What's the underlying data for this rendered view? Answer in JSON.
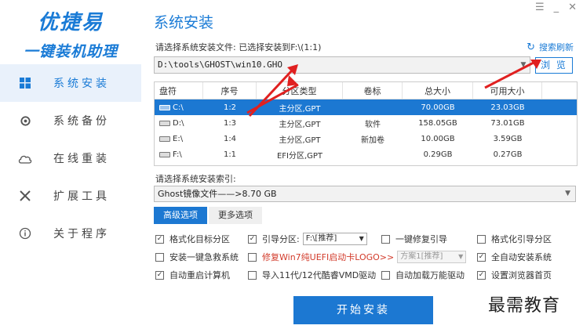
{
  "brand": {
    "title": "优捷易",
    "subtitle": "一键装机助理"
  },
  "window_controls": [
    "☰",
    "_",
    "✕"
  ],
  "nav": [
    {
      "label": "系统安装",
      "icon": "windows-icon",
      "active": true
    },
    {
      "label": "系统备份",
      "icon": "backup-icon",
      "active": false
    },
    {
      "label": "在线重装",
      "icon": "cloud-icon",
      "active": false
    },
    {
      "label": "扩展工具",
      "icon": "tools-icon",
      "active": false
    },
    {
      "label": "关于程序",
      "icon": "info-icon",
      "active": false
    }
  ],
  "main": {
    "title": "系统安装",
    "file_label": "请选择系统安装文件: 已选择安装到F:\\(1:1)",
    "refresh_label": "搜索刷新",
    "path_value": "D:\\tools\\GHOST\\win10.GHO",
    "browse_label": "浏 览"
  },
  "table": {
    "headers": [
      "盘符",
      "序号",
      "分区类型",
      "卷标",
      "总大小",
      "可用大小"
    ],
    "rows": [
      [
        "C:\\",
        "1:2",
        "主分区,GPT",
        "",
        "70.00GB",
        "23.03GB"
      ],
      [
        "D:\\",
        "1:3",
        "主分区,GPT",
        "软件",
        "158.05GB",
        "73.01GB"
      ],
      [
        "E:\\",
        "1:4",
        "主分区,GPT",
        "新加卷",
        "10.00GB",
        "3.59GB"
      ],
      [
        "F:\\",
        "1:1",
        "EFI分区,GPT",
        "",
        "0.29GB",
        "0.27GB"
      ]
    ],
    "selected_row": 0
  },
  "index": {
    "label": "请选择系统安装索引:",
    "value": "Ghost镜像文件——>8.70 GB"
  },
  "tabs": [
    {
      "label": "高级选项",
      "active": true
    },
    {
      "label": "更多选项",
      "active": false
    }
  ],
  "options": {
    "format_target": {
      "label": "格式化目标分区",
      "checked": true
    },
    "boot_partition": {
      "label": "引导分区:",
      "checked": true,
      "select_value": "F:\\[推荐]"
    },
    "one_key_repair": {
      "label": "一键修复引导",
      "checked": false
    },
    "format_boot": {
      "label": "格式化引导分区",
      "checked": false
    },
    "install_rescue": {
      "label": "安装一键急救系统",
      "checked": false
    },
    "fix_logo": {
      "label": "修复Win7纯UEFI启动卡LOGO>>",
      "checked": false,
      "select_value": "方案1[推荐]"
    },
    "auto_install": {
      "label": "全自动安装系统",
      "checked": true
    },
    "auto_restart": {
      "label": "自动重启计算机",
      "checked": true
    },
    "import_vmd": {
      "label": "导入11代/12代酷睿VMD驱动",
      "checked": false
    },
    "auto_driver": {
      "label": "自动加载万能驱动",
      "checked": false
    },
    "set_homepage": {
      "label": "设置浏览器首页",
      "checked": true
    }
  },
  "start_label": "开始安装",
  "watermark": "最需教育",
  "colors": {
    "accent": "#1c78d2",
    "arrow": "#e02020"
  }
}
